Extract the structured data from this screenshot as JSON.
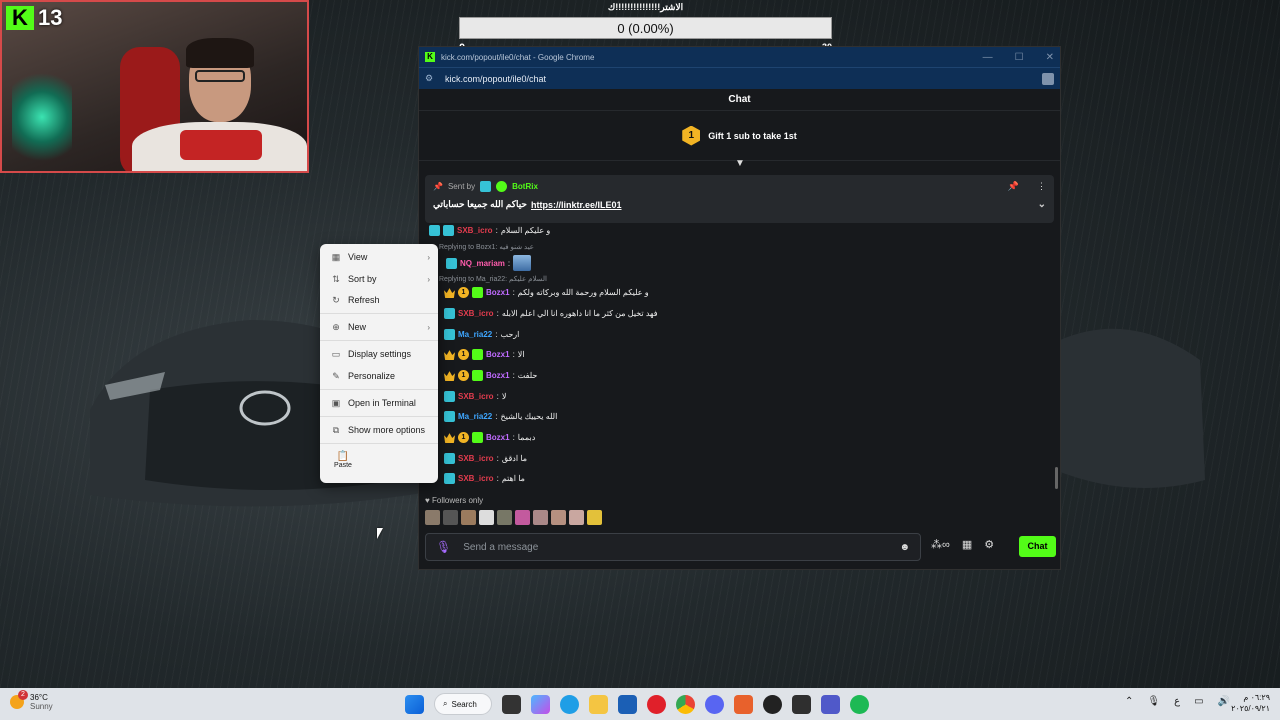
{
  "webcam": {
    "viewer_count": "13",
    "platform_logo": "K"
  },
  "goal": {
    "title": "الاشتر!!!!!!!!!!!!!!!ك",
    "value": "0 (0.00%)",
    "min": "0",
    "max": "30",
    "progress": 0
  },
  "browser": {
    "title": "kick.com/popout/ile0/chat - Google Chrome",
    "url": "kick.com/popout/ile0/chat",
    "chat_header": "Chat",
    "gift_text": "Gift 1 sub to take 1st",
    "gift_rank": "1",
    "pinned": {
      "sent_by": "Sent by",
      "sender": "BotRix",
      "message": "حياكم الله جميعا حساباتي",
      "link": "https://linktr.ee/ILE01"
    },
    "messages": [
      {
        "user": "SXB_icro",
        "text": "و عليكم السلام",
        "color": "red",
        "badges": [
          "k"
        ]
      },
      {
        "reply_to": "Replying to Bozx1:",
        "reply_text": "عيد شنو فيه"
      },
      {
        "user": "NQ_mariam",
        "text": "",
        "color": "pink",
        "badges": [
          "k"
        ],
        "emote": true
      },
      {
        "reply_to": "Replying to Ma_ria22:",
        "reply_text": "السلام عليكم"
      },
      {
        "user": "Bozx1",
        "text": "و عليكم السلام ورحمة الله وبركاته ولكم",
        "color": "purple",
        "badges": [
          "crown",
          "coin",
          "gift"
        ]
      },
      {
        "user": "SXB_icro",
        "text": "فهد تخيل من كثر ما انا داهوره انا الي اعلم الابله",
        "color": "red",
        "badges": [
          "k"
        ]
      },
      {
        "user": "Ma_ria22",
        "text": "ارحب",
        "color": "blue",
        "badges": [
          "k"
        ]
      },
      {
        "user": "Bozx1",
        "text": "الا",
        "color": "purple",
        "badges": [
          "crown",
          "coin",
          "gift"
        ]
      },
      {
        "user": "Bozx1",
        "text": "حلفت",
        "color": "purple",
        "badges": [
          "crown",
          "coin",
          "gift"
        ]
      },
      {
        "user": "SXB_icro",
        "text": "لا",
        "color": "red",
        "badges": [
          "k"
        ]
      },
      {
        "user": "Ma_ria22",
        "text": "الله يحييك يالشيخ",
        "color": "blue",
        "badges": [
          "k"
        ]
      },
      {
        "user": "Bozx1",
        "text": "دبمما",
        "color": "purple",
        "badges": [
          "crown",
          "coin",
          "gift"
        ]
      },
      {
        "user": "SXB_icro",
        "text": "ما ادقق",
        "color": "red",
        "badges": [
          "k"
        ]
      },
      {
        "user": "SXB_icro",
        "text": "ما اهتم",
        "color": "red",
        "badges": [
          "k"
        ]
      }
    ],
    "followers_label": "Followers only",
    "composer_placeholder": "Send a message",
    "send_label": "Chat"
  },
  "context_menu": {
    "items": [
      {
        "label": "View",
        "icon": "grid-icon",
        "submenu": true
      },
      {
        "label": "Sort by",
        "icon": "sort-icon",
        "submenu": true
      },
      {
        "label": "Refresh",
        "icon": "refresh-icon",
        "submenu": false
      },
      {
        "label": "New",
        "icon": "plus-icon",
        "submenu": true
      },
      {
        "label": "Display settings",
        "icon": "display-icon",
        "submenu": false
      },
      {
        "label": "Personalize",
        "icon": "brush-icon",
        "submenu": false
      },
      {
        "label": "Open in Terminal",
        "icon": "terminal-icon",
        "submenu": false
      },
      {
        "label": "Show more options",
        "icon": "more-options-icon",
        "submenu": false
      }
    ],
    "paste_label": "Paste"
  },
  "taskbar": {
    "temperature": "36°C",
    "weather": "Sunny",
    "weather_badge": "2",
    "search_label": "Search",
    "lang": "ع",
    "time": "٠٦:٢٩ م",
    "date": "٢٠٢٥/٠٩/٢١"
  }
}
